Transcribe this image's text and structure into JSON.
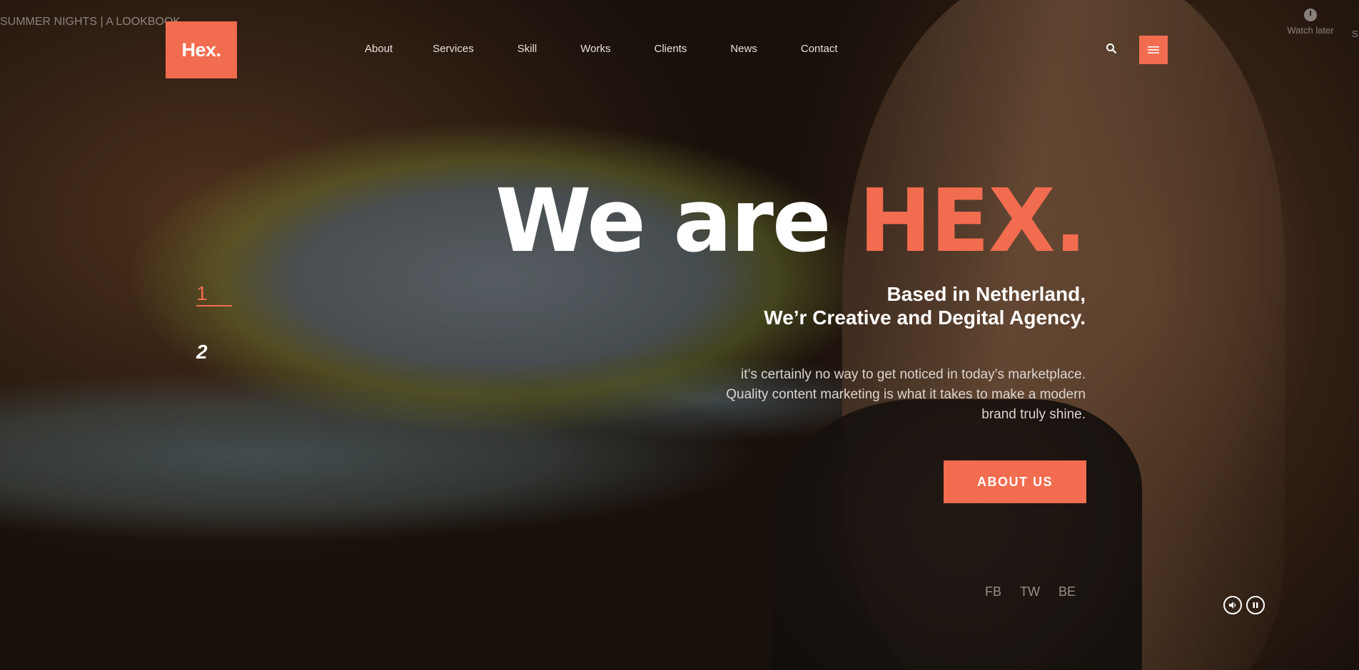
{
  "video_overlay": {
    "title": "SUMMER NIGHTS | A LOOKBOOK",
    "watch_later": "Watch later",
    "share_partial": "S"
  },
  "brand": {
    "logo": "Hex."
  },
  "nav": {
    "items": [
      "About",
      "Services",
      "Skill",
      "Works",
      "Clients",
      "News",
      "Contact"
    ]
  },
  "slides": {
    "active": "1",
    "next": "2"
  },
  "hero": {
    "title_main": "We are ",
    "title_accent": "HEX.",
    "subtitle_line1": "Based in Netherland,",
    "subtitle_line2": "We’r Creative and Degital Agency.",
    "desc_line1": "it’s certainly no way to get noticed in today’s marketplace.",
    "desc_line2": "Quality content marketing is what it takes to make a modern",
    "desc_line3": "brand truly shine.",
    "cta": "ABOUT US"
  },
  "social": [
    "FB",
    "TW",
    "BE"
  ],
  "colors": {
    "accent": "#f26c4f",
    "text": "#ffffff"
  },
  "icons": {
    "search": "search-icon",
    "menu": "hamburger-menu-icon",
    "volume": "volume-icon",
    "pause": "pause-icon",
    "clock": "clock-icon"
  }
}
